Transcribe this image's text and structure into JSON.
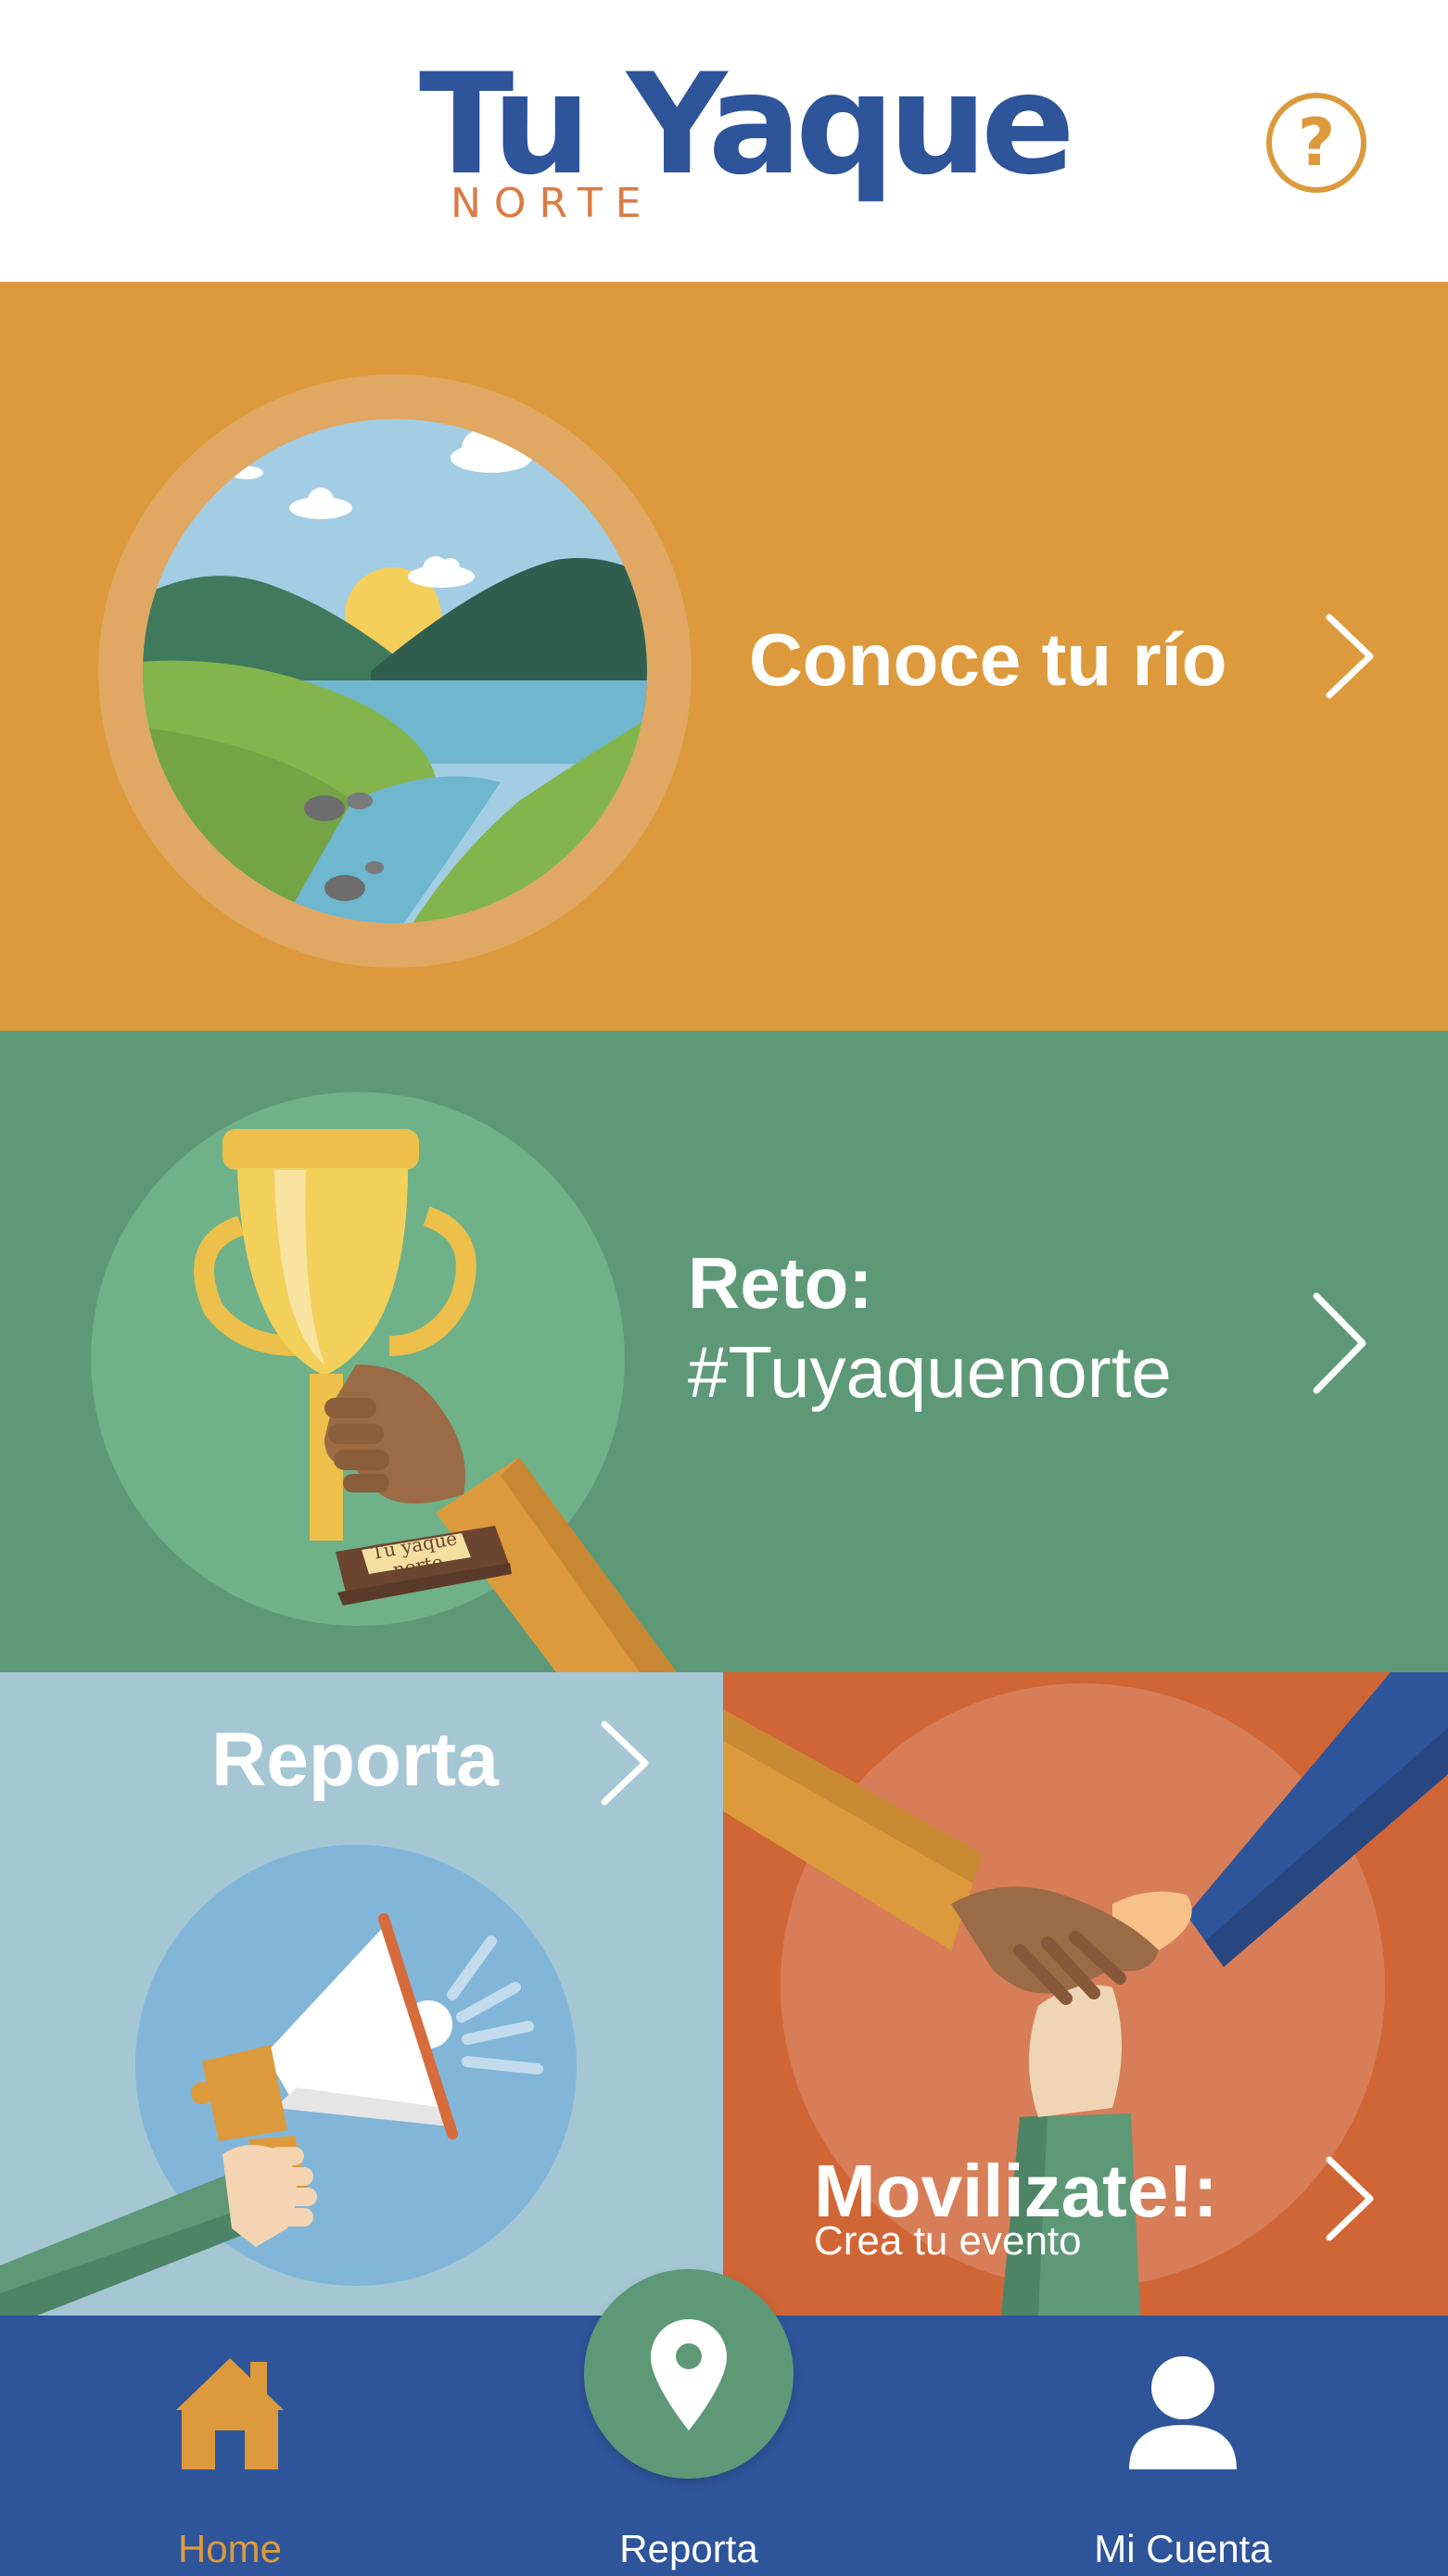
{
  "header": {
    "logo_title": "Tu Yaque",
    "logo_subtitle": "NORTE",
    "help_label": "?"
  },
  "cards": {
    "rio": {
      "title": "Conoce tu río"
    },
    "reto": {
      "title": "Reto:",
      "subtitle": "#Tuyaquenorte",
      "trophy_plaque": "Tu yaque norte"
    },
    "reporta": {
      "title": "Reporta"
    },
    "movilizate": {
      "title": "Movilizate!:",
      "subtitle": "Crea tu evento"
    }
  },
  "bottom_nav": {
    "items": [
      {
        "label": "Home",
        "icon": "home-icon",
        "active": true
      },
      {
        "label": "Reporta",
        "icon": "map-pin-icon",
        "active": false
      },
      {
        "label": "Mi Cuenta",
        "icon": "user-icon",
        "active": false
      }
    ]
  },
  "colors": {
    "brand_blue": "#2e549a",
    "orange": "#dc9a3c",
    "green": "#5e9977",
    "light_blue": "#a5c7d4",
    "red_orange": "#d06636",
    "logo_accent": "#dc7a44"
  }
}
